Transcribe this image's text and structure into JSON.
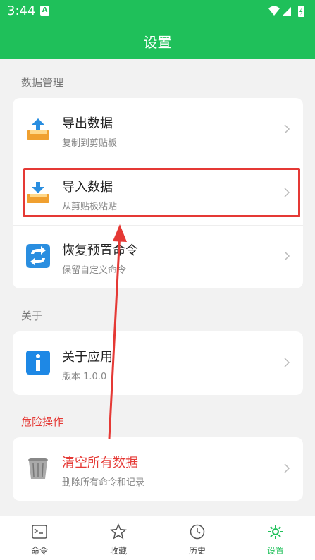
{
  "status": {
    "time": "3:44",
    "notif_letter": "A"
  },
  "appbar": {
    "title": "设置"
  },
  "sections": {
    "data": {
      "title": "数据管理"
    },
    "about": {
      "title": "关于"
    },
    "danger": {
      "title": "危险操作"
    }
  },
  "rows": {
    "export": {
      "title": "导出数据",
      "sub": "复制到剪贴板"
    },
    "import": {
      "title": "导入数据",
      "sub": "从剪贴板粘贴"
    },
    "restore": {
      "title": "恢复预置命令",
      "sub": "保留自定义命令"
    },
    "about": {
      "title": "关于应用",
      "sub": "版本 1.0.0"
    },
    "clear": {
      "title": "清空所有数据",
      "sub": "删除所有命令和记录"
    }
  },
  "nav": {
    "commands": "命令",
    "favorites": "收藏",
    "history": "历史",
    "settings": "设置"
  },
  "colors": {
    "accent": "#1fc05a",
    "danger": "#e53935"
  },
  "icons": {
    "export": "upload-tray-icon",
    "import": "download-tray-icon",
    "restore": "refresh-icon",
    "about": "info-icon",
    "clear": "trash-icon"
  }
}
